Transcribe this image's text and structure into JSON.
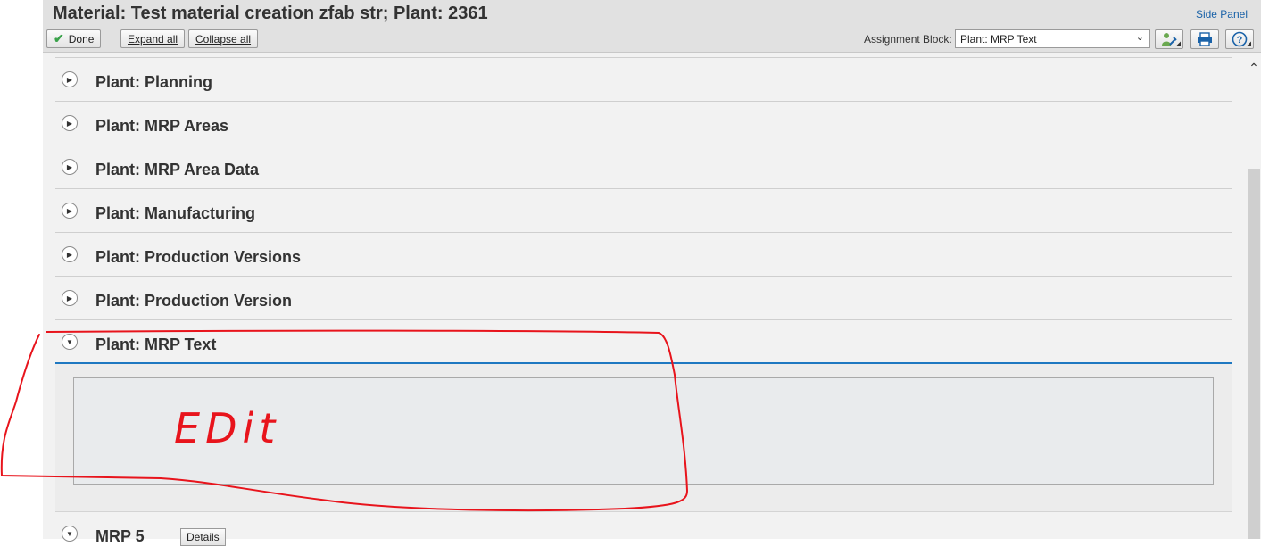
{
  "header": {
    "title": "Material: Test material creation zfab str; Plant: 2361",
    "side_panel": "Side Panel"
  },
  "toolbar": {
    "done_label": "Done",
    "expand_all_label": "Expand all",
    "collapse_all_label": "Collapse all",
    "assignment_block_label": "Assignment Block:",
    "assignment_block_value": "Plant: MRP Text",
    "icons": [
      "personalize-icon",
      "print-icon",
      "help-icon"
    ]
  },
  "sections": [
    {
      "title": "Plant: Planning",
      "state": "collapsed"
    },
    {
      "title": "Plant: MRP Areas",
      "state": "collapsed"
    },
    {
      "title": "Plant: MRP Area Data",
      "state": "collapsed"
    },
    {
      "title": "Plant: Manufacturing",
      "state": "collapsed"
    },
    {
      "title": "Plant: Production Versions",
      "state": "collapsed"
    },
    {
      "title": "Plant: Production Version",
      "state": "collapsed"
    },
    {
      "title": "Plant: MRP Text",
      "state": "expanded"
    }
  ],
  "next_section": {
    "title": "MRP 5",
    "details_label": "Details"
  },
  "annotation": {
    "text": "EDit",
    "color": "#e8141c"
  },
  "colors": {
    "accent": "#1f78c1",
    "link": "#1a62a8",
    "annotation": "#e8141c"
  }
}
